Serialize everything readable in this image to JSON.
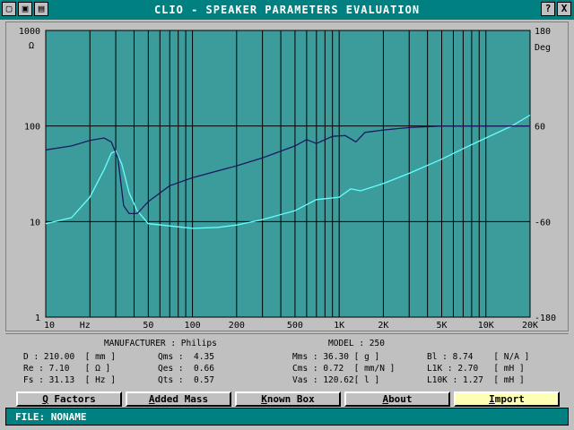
{
  "window": {
    "title": "CLIO - SPEAKER PARAMETERS EVALUATION",
    "system_icons": [
      "folder-icon",
      "save-icon",
      "printer-icon"
    ],
    "help_label": "?",
    "close_label": "X"
  },
  "chart_data": {
    "type": "line",
    "x_scale": "log",
    "xlim": [
      10,
      20000
    ],
    "x_tick_labels": [
      "10",
      "Hz",
      "50",
      "100",
      "200",
      "500",
      "1K",
      "2K",
      "5K",
      "10K",
      "20K"
    ],
    "left_axis": {
      "label": "Ω",
      "scale": "log",
      "ylim": [
        1,
        1000
      ],
      "tick_labels": [
        "1000",
        "100",
        "10",
        "1"
      ]
    },
    "right_axis": {
      "label": "Deg",
      "ylim": [
        -180,
        180
      ],
      "tick_labels": [
        "180",
        "60",
        "-60",
        "-180"
      ]
    },
    "colors": {
      "background": "#3c9c9c",
      "grid": "#000000",
      "impedance": "#66ffff",
      "phase": "#1a1a60"
    },
    "series": [
      {
        "axis": "left",
        "points": [
          [
            10,
            9.5
          ],
          [
            15,
            11
          ],
          [
            20,
            18
          ],
          [
            25,
            35
          ],
          [
            28,
            52
          ],
          [
            30,
            55
          ],
          [
            33,
            40
          ],
          [
            37,
            20
          ],
          [
            42,
            13
          ],
          [
            50,
            9.5
          ],
          [
            70,
            9
          ],
          [
            100,
            8.5
          ],
          [
            150,
            8.7
          ],
          [
            200,
            9.2
          ],
          [
            300,
            10.5
          ],
          [
            500,
            13
          ],
          [
            700,
            17
          ],
          [
            1000,
            18
          ],
          [
            1200,
            22
          ],
          [
            1400,
            21
          ],
          [
            2000,
            25
          ],
          [
            3000,
            32
          ],
          [
            5000,
            45
          ],
          [
            7000,
            58
          ],
          [
            10000,
            75
          ],
          [
            15000,
            100
          ],
          [
            20000,
            130
          ]
        ]
      },
      {
        "axis": "right",
        "points": [
          [
            10,
            30
          ],
          [
            15,
            35
          ],
          [
            20,
            42
          ],
          [
            25,
            45
          ],
          [
            28,
            40
          ],
          [
            31,
            20
          ],
          [
            34,
            -40
          ],
          [
            37,
            -50
          ],
          [
            42,
            -50
          ],
          [
            50,
            -35
          ],
          [
            70,
            -15
          ],
          [
            100,
            -5
          ],
          [
            200,
            10
          ],
          [
            300,
            20
          ],
          [
            500,
            35
          ],
          [
            600,
            43
          ],
          [
            700,
            38
          ],
          [
            900,
            47
          ],
          [
            1100,
            48
          ],
          [
            1300,
            40
          ],
          [
            1500,
            52
          ],
          [
            2000,
            55
          ],
          [
            3000,
            58
          ],
          [
            5000,
            60
          ],
          [
            10000,
            60
          ],
          [
            20000,
            60
          ]
        ]
      }
    ]
  },
  "parameters": {
    "manufacturer_label": "MANUFACTURER : Philips",
    "model_label": "MODEL : 250",
    "rows": [
      [
        "D : 210.00  [ mm ]",
        "Qms :  4.35",
        "Mms : 36.30 [ g ]",
        "Bl : 8.74    [ N/A ]"
      ],
      [
        "Re : 7.10   [ Ω ]",
        "Qes :  0.66",
        "Cms : 0.72  [ mm/N ]",
        "L1K : 2.70   [ mH ]"
      ],
      [
        "Fs : 31.13  [ Hz ]",
        "Qts :  0.57",
        "Vas : 120.62[ l ]",
        "L10K : 1.27  [ mH ]"
      ]
    ]
  },
  "buttons": [
    {
      "hot": "Q",
      "rest": " Factors",
      "active": false
    },
    {
      "hot": "A",
      "rest": "dded Mass",
      "active": false
    },
    {
      "hot": "K",
      "rest": "nown Box",
      "active": false
    },
    {
      "hot": "A",
      "rest": "bout",
      "active": false
    },
    {
      "hot": "I",
      "rest": "mport",
      "active": true
    }
  ],
  "status": {
    "text": "FILE: NONAME"
  }
}
